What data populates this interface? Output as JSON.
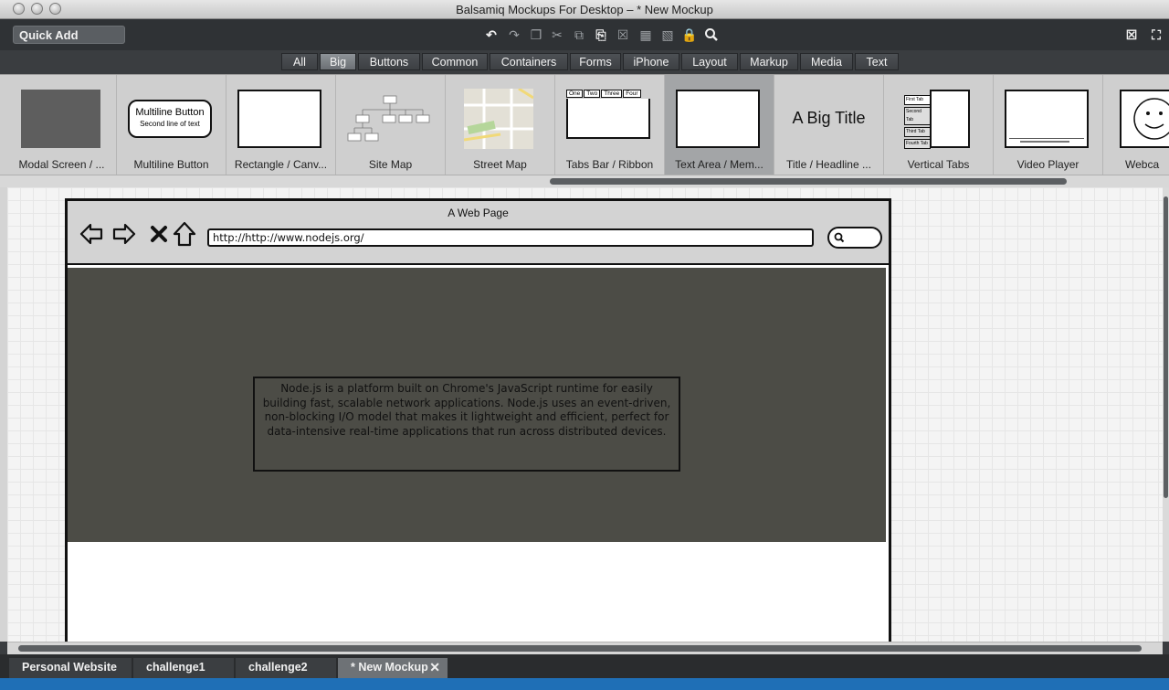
{
  "window": {
    "title": "Balsamiq Mockups For Desktop – * New Mockup"
  },
  "toolbar": {
    "quick_add": "Quick Add",
    "icons": [
      "undo-icon",
      "redo-icon",
      "duplicate-icon",
      "cut-icon",
      "copy-icon",
      "paste-icon",
      "delete-icon",
      "group-icon",
      "ungroup-icon",
      "lock-icon",
      "search-icon"
    ],
    "right_icons": [
      "close-box-icon",
      "fullscreen-icon"
    ]
  },
  "filters": [
    "All",
    "Big",
    "Buttons",
    "Common",
    "Containers",
    "Forms",
    "iPhone",
    "Layout",
    "Markup",
    "Media",
    "Text"
  ],
  "active_filter": "Big",
  "components": {
    "modal": "Modal Screen / ...",
    "multiline": "Multiline Button",
    "multiline_line1": "Multiline Button",
    "multiline_line2": "Second line of text",
    "rectangle": "Rectangle / Canv...",
    "sitemap": "Site Map",
    "streetmap": "Street Map",
    "tabsbar": "Tabs Bar / Ribbon",
    "tabs_preview": [
      "One",
      "Two",
      "Three",
      "Four"
    ],
    "textarea": "Text Area / Mem...",
    "title": "Title / Headline ...",
    "title_preview": "A Big Title",
    "verticaltabs": "Vertical Tabs",
    "vtabs_preview": [
      "First Tab",
      "Second Tab",
      "Third Tab",
      "Fourth Tab"
    ],
    "videoplayer": "Video Player",
    "webcam": "Webca"
  },
  "mockup": {
    "page_title": "A Web Page",
    "url": "http://http://www.nodejs.org/",
    "body_text": "Node.js is a platform built on Chrome's JavaScript runtime for easily building fast, scalable network applications. Node.js uses an event-driven, non-blocking I/O model that makes it lightweight and efficient, perfect for data-intensive real-time applications that run across distributed devices."
  },
  "doc_tabs": [
    "Personal Website",
    "challenge1",
    "challenge2",
    "* New Mockup"
  ],
  "active_doc_tab": "* New Mockup",
  "colors": {
    "content_bg": "#4c4c46",
    "selected_component": "#a3a5a7",
    "status_bar": "#1f6fb6"
  }
}
